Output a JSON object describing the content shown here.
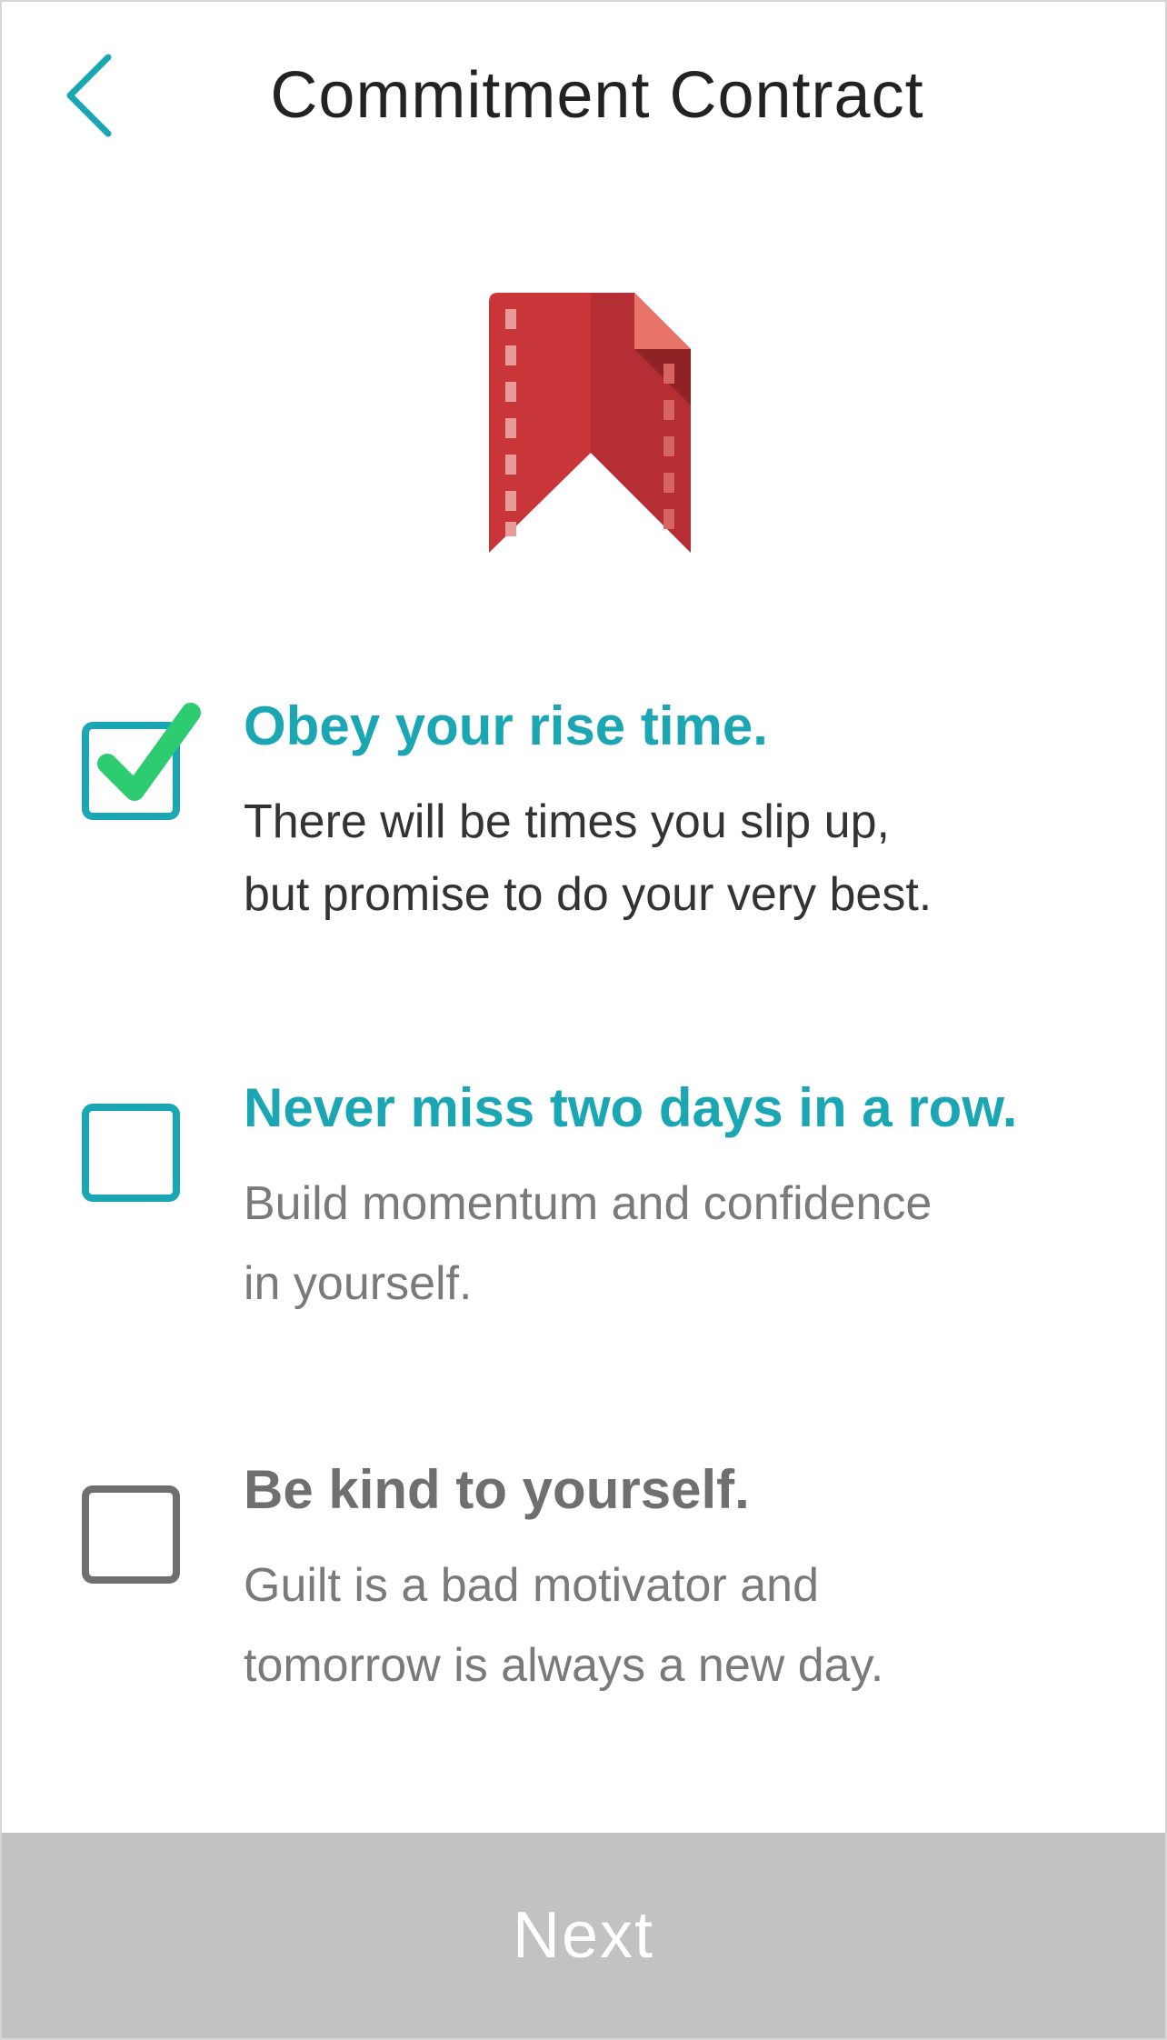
{
  "header": {
    "title": "Commitment Contract",
    "back_icon": "chevron-left-icon"
  },
  "graphic": {
    "icon": "ribbon-bookmark-icon",
    "colors": {
      "primary": "#c9363a",
      "fold": "#e8746a",
      "stitch": "#e89a97"
    }
  },
  "items": [
    {
      "heading": "Obey your rise time.",
      "desc_line1": "There will be times you slip up,",
      "desc_line2": "but promise to do your very best.",
      "checked": true
    },
    {
      "heading": "Never miss two days in a row.",
      "desc_line1": "Build momentum and confidence",
      "desc_line2": "in yourself.",
      "checked": false
    },
    {
      "heading": "Be kind to yourself.",
      "desc_line1": "Guilt is a bad motivator and",
      "desc_line2": "tomorrow is always a new day.",
      "checked": false
    }
  ],
  "footer": {
    "next_label": "Next"
  },
  "colors": {
    "accent": "#1aa7b3",
    "check_green": "#2ecc71",
    "disabled_button": "#c2c2c2"
  }
}
